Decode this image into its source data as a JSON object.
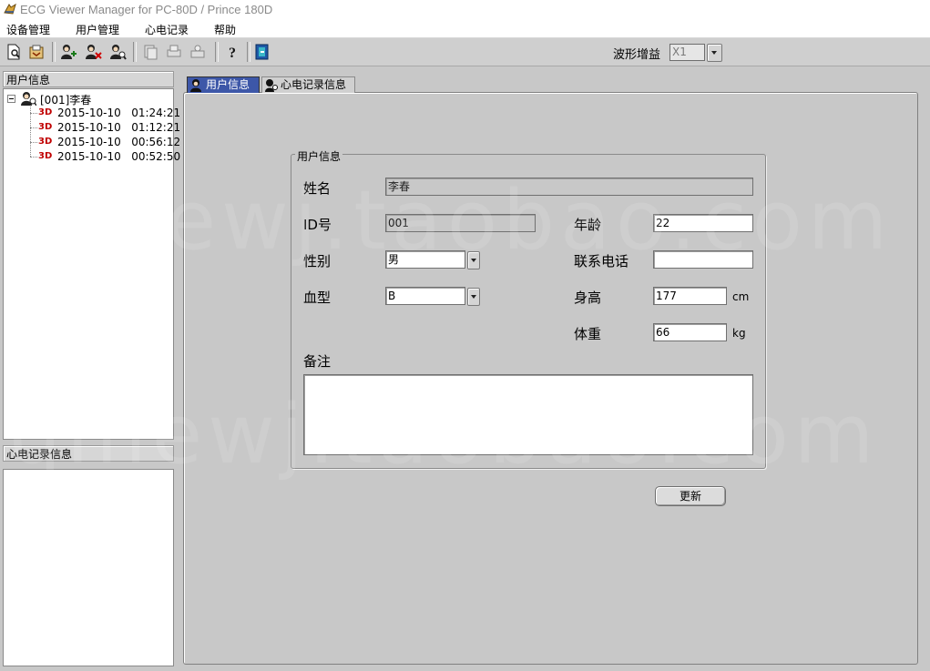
{
  "window": {
    "title": "ECG Viewer Manager for PC-80D / Prince 180D"
  },
  "menu": {
    "items": [
      "设备管理",
      "用户管理",
      "心电记录",
      "帮助"
    ]
  },
  "toolbar": {
    "buttons": [
      "new-document-icon",
      "export-icon",
      "add-user-icon",
      "delete-user-icon",
      "search-user-icon",
      "copy-icon",
      "print-icon",
      "print-preview-icon",
      "help-icon",
      "exit-icon"
    ],
    "gain_label": "波形增益",
    "gain_value": "X1"
  },
  "left": {
    "user_panel_title": "用户信息",
    "tree": {
      "user": "[001]李春",
      "records": [
        {
          "badge": "3D",
          "date": "2015-10-10",
          "time": "01:24:21"
        },
        {
          "badge": "3D",
          "date": "2015-10-10",
          "time": "01:12:21"
        },
        {
          "badge": "3D",
          "date": "2015-10-10",
          "time": "00:56:12"
        },
        {
          "badge": "3D",
          "date": "2015-10-10",
          "time": "00:52:50"
        }
      ]
    },
    "ecg_panel_title": "心电记录信息"
  },
  "tabs": [
    {
      "label": "用户信息",
      "active": true
    },
    {
      "label": "心电记录信息",
      "active": false
    }
  ],
  "form": {
    "group_title": "用户信息",
    "name": {
      "label": "姓名",
      "value": "李春"
    },
    "id": {
      "label": "ID号",
      "value": "001"
    },
    "age": {
      "label": "年龄",
      "value": "22"
    },
    "gender": {
      "label": "性别",
      "value": "男"
    },
    "phone": {
      "label": "联系电话",
      "value": ""
    },
    "blood": {
      "label": "血型",
      "value": "B"
    },
    "height": {
      "label": "身高",
      "value": "177",
      "unit": "cm"
    },
    "weight": {
      "label": "体重",
      "value": "66",
      "unit": "kg"
    },
    "notes": {
      "label": "备注",
      "value": ""
    },
    "update_button": "更新"
  },
  "watermark": "qmewj.taobao.com",
  "colors": {
    "active_tab": "#3d57a8",
    "badge_3d": "#c00000"
  }
}
